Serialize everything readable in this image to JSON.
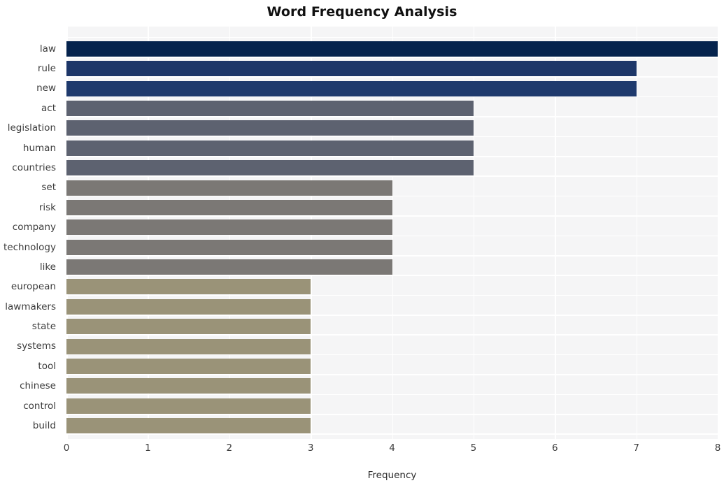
{
  "chart_data": {
    "type": "bar",
    "orientation": "horizontal",
    "title": "Word Frequency Analysis",
    "xlabel": "Frequency",
    "ylabel": "",
    "xlim": [
      0,
      8
    ],
    "xticks": [
      0,
      1,
      2,
      3,
      4,
      5,
      6,
      7,
      8
    ],
    "xtick_labels": [
      "0",
      "1",
      "2",
      "3",
      "4",
      "5",
      "6",
      "7",
      "8"
    ],
    "grid": true,
    "legend": "none",
    "categories": [
      "law",
      "rule",
      "new",
      "act",
      "legislation",
      "human",
      "countries",
      "set",
      "risk",
      "company",
      "technology",
      "like",
      "european",
      "lawmakers",
      "state",
      "systems",
      "tool",
      "chinese",
      "control",
      "build"
    ],
    "values": [
      8,
      7,
      7,
      5,
      5,
      5,
      5,
      4,
      4,
      4,
      4,
      4,
      3,
      3,
      3,
      3,
      3,
      3,
      3,
      3
    ],
    "bar_colors": [
      "#05234d",
      "#1d3668",
      "#1f3a6d",
      "#5d6270",
      "#5d6270",
      "#5d6270",
      "#5d6270",
      "#7b7875",
      "#7b7875",
      "#7b7875",
      "#7b7875",
      "#7b7875",
      "#9a9378",
      "#9a9378",
      "#9a9378",
      "#9a9378",
      "#9a9378",
      "#9a9378",
      "#9a9378",
      "#9a9378"
    ]
  },
  "style": {
    "plot_background": "#f5f5f6",
    "grid_color": "#ffffff",
    "figure_background": "#ffffff",
    "text_color": "#3c3c3c",
    "title_color": "#101010"
  }
}
